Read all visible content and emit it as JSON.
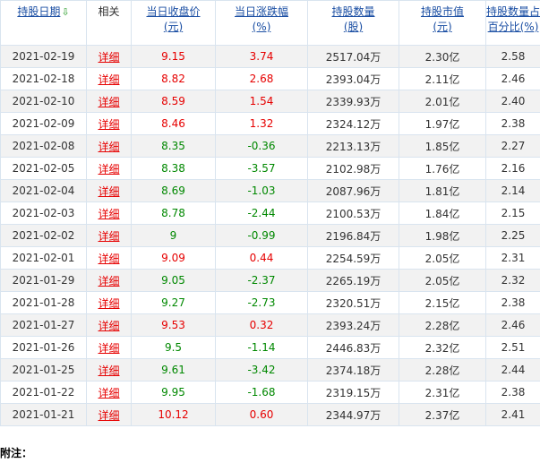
{
  "headers": {
    "date": "持股日期",
    "related": "相关",
    "close_line1": "当日收盘价",
    "close_line2": "(元)",
    "change_line1": "当日涨跌幅",
    "change_line2": "(%)",
    "qty_line1": "持股数量",
    "qty_line2": "(股)",
    "value_line1": "持股市值",
    "value_line2": "(元)",
    "pct_line1": "持股数量占A股",
    "pct_line2": "百分比(%)"
  },
  "sort_arrow": "⇩",
  "colors": {
    "up": "#e60000",
    "down": "#008800",
    "link": "#e60000",
    "header": "#1a4ea3"
  },
  "rows": [
    {
      "date": "2021-02-19",
      "link": "详细",
      "close": "9.15",
      "change": "3.74",
      "qty": "2517.04万",
      "value": "2.30亿",
      "pct": "2.58",
      "dir": "up"
    },
    {
      "date": "2021-02-18",
      "link": "详细",
      "close": "8.82",
      "change": "2.68",
      "qty": "2393.04万",
      "value": "2.11亿",
      "pct": "2.46",
      "dir": "up"
    },
    {
      "date": "2021-02-10",
      "link": "详细",
      "close": "8.59",
      "change": "1.54",
      "qty": "2339.93万",
      "value": "2.01亿",
      "pct": "2.40",
      "dir": "up"
    },
    {
      "date": "2021-02-09",
      "link": "详细",
      "close": "8.46",
      "change": "1.32",
      "qty": "2324.12万",
      "value": "1.97亿",
      "pct": "2.38",
      "dir": "up"
    },
    {
      "date": "2021-02-08",
      "link": "详细",
      "close": "8.35",
      "change": "-0.36",
      "qty": "2213.13万",
      "value": "1.85亿",
      "pct": "2.27",
      "dir": "down"
    },
    {
      "date": "2021-02-05",
      "link": "详细",
      "close": "8.38",
      "change": "-3.57",
      "qty": "2102.98万",
      "value": "1.76亿",
      "pct": "2.16",
      "dir": "down"
    },
    {
      "date": "2021-02-04",
      "link": "详细",
      "close": "8.69",
      "change": "-1.03",
      "qty": "2087.96万",
      "value": "1.81亿",
      "pct": "2.14",
      "dir": "down"
    },
    {
      "date": "2021-02-03",
      "link": "详细",
      "close": "8.78",
      "change": "-2.44",
      "qty": "2100.53万",
      "value": "1.84亿",
      "pct": "2.15",
      "dir": "down"
    },
    {
      "date": "2021-02-02",
      "link": "详细",
      "close": "9",
      "change": "-0.99",
      "qty": "2196.84万",
      "value": "1.98亿",
      "pct": "2.25",
      "dir": "down"
    },
    {
      "date": "2021-02-01",
      "link": "详细",
      "close": "9.09",
      "change": "0.44",
      "qty": "2254.59万",
      "value": "2.05亿",
      "pct": "2.31",
      "dir": "up"
    },
    {
      "date": "2021-01-29",
      "link": "详细",
      "close": "9.05",
      "change": "-2.37",
      "qty": "2265.19万",
      "value": "2.05亿",
      "pct": "2.32",
      "dir": "down"
    },
    {
      "date": "2021-01-28",
      "link": "详细",
      "close": "9.27",
      "change": "-2.73",
      "qty": "2320.51万",
      "value": "2.15亿",
      "pct": "2.38",
      "dir": "down"
    },
    {
      "date": "2021-01-27",
      "link": "详细",
      "close": "9.53",
      "change": "0.32",
      "qty": "2393.24万",
      "value": "2.28亿",
      "pct": "2.46",
      "dir": "up"
    },
    {
      "date": "2021-01-26",
      "link": "详细",
      "close": "9.5",
      "change": "-1.14",
      "qty": "2446.83万",
      "value": "2.32亿",
      "pct": "2.51",
      "dir": "down"
    },
    {
      "date": "2021-01-25",
      "link": "详细",
      "close": "9.61",
      "change": "-3.42",
      "qty": "2374.18万",
      "value": "2.28亿",
      "pct": "2.44",
      "dir": "down"
    },
    {
      "date": "2021-01-22",
      "link": "详细",
      "close": "9.95",
      "change": "-1.68",
      "qty": "2319.15万",
      "value": "2.31亿",
      "pct": "2.38",
      "dir": "down"
    },
    {
      "date": "2021-01-21",
      "link": "详细",
      "close": "10.12",
      "change": "0.60",
      "qty": "2344.97万",
      "value": "2.37亿",
      "pct": "2.41",
      "dir": "up"
    }
  ],
  "notes_label": "附注："
}
